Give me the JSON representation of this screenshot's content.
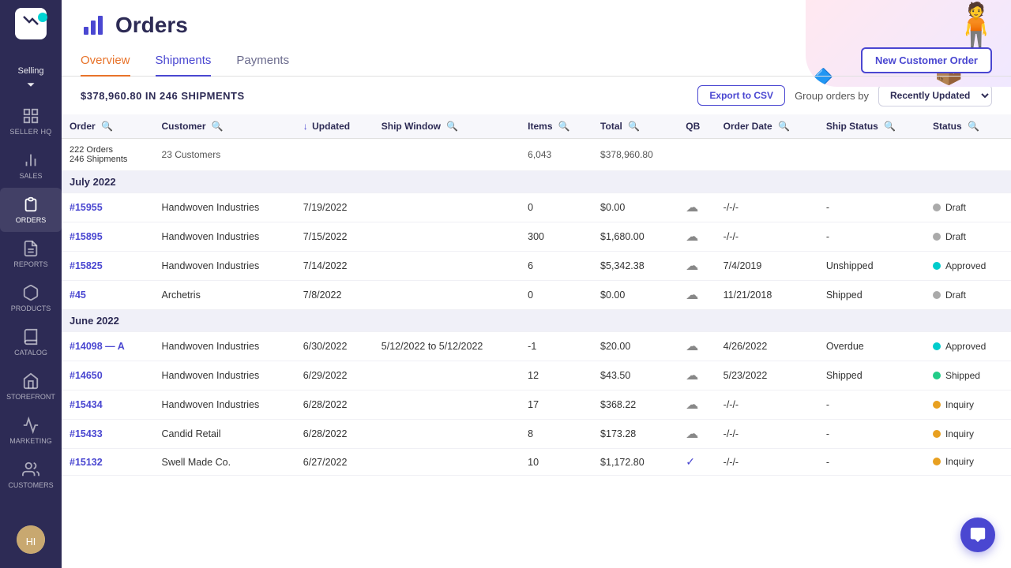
{
  "sidebar": {
    "logo_label": "Logo",
    "selling_label": "Selling",
    "items": [
      {
        "id": "seller-hq",
        "label": "SELLER HQ",
        "icon": "home"
      },
      {
        "id": "sales",
        "label": "SALES",
        "icon": "chart-bar"
      },
      {
        "id": "orders",
        "label": "ORDERS",
        "icon": "list",
        "active": true
      },
      {
        "id": "reports",
        "label": "REPORTS",
        "icon": "file"
      },
      {
        "id": "products",
        "label": "PRODUCTS",
        "icon": "box"
      },
      {
        "id": "catalog",
        "label": "CATALOG",
        "icon": "book"
      },
      {
        "id": "storefront",
        "label": "STOREFRONT",
        "icon": "store"
      },
      {
        "id": "marketing",
        "label": "MARKETING",
        "icon": "megaphone"
      },
      {
        "id": "customers",
        "label": "CUSTOMERS",
        "icon": "users"
      }
    ]
  },
  "header": {
    "title": "Orders",
    "icon": "bar-chart"
  },
  "tabs": [
    {
      "id": "overview",
      "label": "Overview",
      "state": "active"
    },
    {
      "id": "shipments",
      "label": "Shipments",
      "state": "selected"
    },
    {
      "id": "payments",
      "label": "Payments",
      "state": "normal"
    }
  ],
  "new_order_btn": "New Customer Order",
  "toolbar": {
    "summary": "$378,960.80 IN 246 SHIPMENTS",
    "export_btn": "Export to CSV",
    "group_label": "Group orders by",
    "group_value": "Recently Updated"
  },
  "columns": [
    {
      "id": "order",
      "label": "Order"
    },
    {
      "id": "customer",
      "label": "Customer"
    },
    {
      "id": "updated",
      "label": "Updated",
      "sort": true
    },
    {
      "id": "ship_window",
      "label": "Ship Window"
    },
    {
      "id": "items",
      "label": "Items"
    },
    {
      "id": "total",
      "label": "Total"
    },
    {
      "id": "qb",
      "label": "QB"
    },
    {
      "id": "order_date",
      "label": "Order Date"
    },
    {
      "id": "ship_status",
      "label": "Ship Status"
    },
    {
      "id": "status",
      "label": "Status"
    }
  ],
  "summary_row": {
    "orders": "222 Orders",
    "shipments": "246 Shipments",
    "customers": "23 Customers",
    "items": "6,043",
    "total": "$378,960.80"
  },
  "sections": [
    {
      "id": "july2022",
      "label": "July 2022",
      "rows": [
        {
          "order": "#15955",
          "customer": "Handwoven Industries",
          "updated": "7/19/2022",
          "ship_window": "",
          "items": "0",
          "total": "$0.00",
          "qb": "upload",
          "order_date": "-/-/-",
          "ship_status": "-",
          "status": "Draft",
          "status_color": "gray",
          "ship_status_type": ""
        },
        {
          "order": "#15895",
          "customer": "Handwoven Industries",
          "updated": "7/15/2022",
          "ship_window": "",
          "items": "300",
          "total": "$1,680.00",
          "qb": "upload",
          "order_date": "-/-/-",
          "ship_status": "-",
          "status": "Draft",
          "status_color": "gray",
          "ship_status_type": ""
        },
        {
          "order": "#15825",
          "customer": "Handwoven Industries",
          "updated": "7/14/2022",
          "ship_window": "",
          "items": "6",
          "total": "$5,342.38",
          "qb": "upload",
          "order_date": "7/4/2019",
          "ship_status": "Unshipped",
          "status": "Approved",
          "status_color": "cyan",
          "ship_status_type": ""
        },
        {
          "order": "#45",
          "customer": "Archetris",
          "updated": "7/8/2022",
          "ship_window": "",
          "items": "0",
          "total": "$0.00",
          "qb": "upload",
          "order_date": "11/21/2018",
          "ship_status": "Shipped",
          "status": "Draft",
          "status_color": "gray",
          "ship_status_type": ""
        }
      ]
    },
    {
      "id": "june2022",
      "label": "June 2022",
      "rows": [
        {
          "order": "#14098 — A",
          "customer": "Handwoven Industries",
          "updated": "6/30/2022",
          "ship_window": "5/12/2022 to 5/12/2022",
          "items": "-1",
          "total": "$20.00",
          "qb": "upload",
          "order_date": "4/26/2022",
          "ship_status": "Overdue",
          "status": "Approved",
          "status_color": "cyan",
          "ship_status_type": ""
        },
        {
          "order": "#14650",
          "customer": "Handwoven Industries",
          "updated": "6/29/2022",
          "ship_window": "",
          "items": "12",
          "total": "$43.50",
          "qb": "upload",
          "order_date": "5/23/2022",
          "ship_status": "Shipped",
          "status": "Shipped",
          "status_color": "green",
          "ship_status_type": ""
        },
        {
          "order": "#15434",
          "customer": "Handwoven Industries",
          "updated": "6/28/2022",
          "ship_window": "",
          "items": "17",
          "total": "$368.22",
          "qb": "upload",
          "order_date": "-/-/-",
          "ship_status": "-",
          "status": "Inquiry",
          "status_color": "yellow",
          "ship_status_type": ""
        },
        {
          "order": "#15433",
          "customer": "Candid Retail",
          "updated": "6/28/2022",
          "ship_window": "",
          "items": "8",
          "total": "$173.28",
          "qb": "upload",
          "order_date": "-/-/-",
          "ship_status": "-",
          "status": "Inquiry",
          "status_color": "yellow",
          "ship_status_type": ""
        },
        {
          "order": "#15132",
          "customer": "Swell Made Co.",
          "updated": "6/27/2022",
          "ship_window": "",
          "items": "10",
          "total": "$1,172.80",
          "qb": "check",
          "order_date": "-/-/-",
          "ship_status": "-",
          "status": "Inquiry",
          "status_color": "yellow",
          "ship_status_type": ""
        }
      ]
    }
  ]
}
